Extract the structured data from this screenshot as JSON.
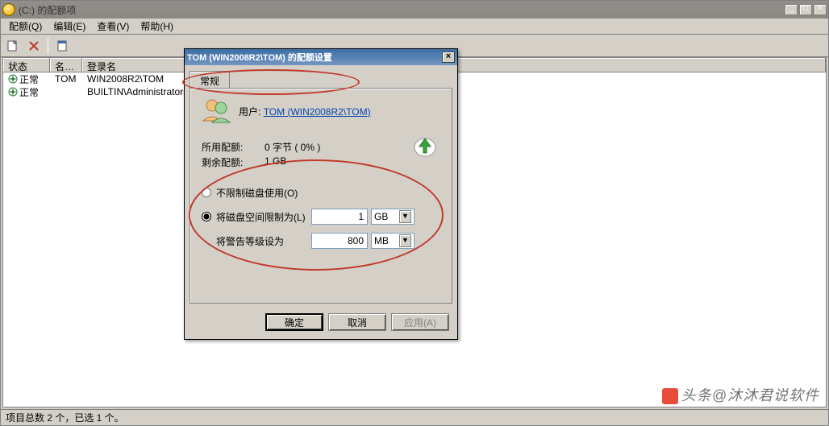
{
  "main": {
    "title": "(C:) 的配额项",
    "menu": {
      "quota": "配额(Q)",
      "edit": "编辑(E)",
      "view": "查看(V)",
      "help": "帮助(H)"
    },
    "columns": {
      "status": "状态",
      "name": "名…",
      "login": "登录名"
    },
    "rows": [
      {
        "status": "正常",
        "name": "TOM",
        "login": "WIN2008R2\\TOM"
      },
      {
        "status": "正常",
        "name": "",
        "login": "BUILTIN\\Administrators"
      }
    ],
    "statusbar": "项目总数 2 个，已选 1 个。"
  },
  "dialog": {
    "title": "TOM (WIN2008R2\\TOM) 的配额设置",
    "tab_general": "常规",
    "user_label": "用户:",
    "user_value": "TOM (WIN2008R2\\TOM)",
    "used_label": "所用配额:",
    "used_value": "0 字节 ( 0% )",
    "remain_label": "剩余配额:",
    "remain_value": "1 GB",
    "radio_nolimit": "不限制磁盘使用(O)",
    "radio_limit": "将磁盘空间限制为(L)",
    "warn_label": "将警告等级设为",
    "limit_value": "1",
    "limit_unit": "GB",
    "warn_value": "800",
    "warn_unit": "MB",
    "btn_ok": "确定",
    "btn_cancel": "取消",
    "btn_apply": "应用(A)"
  },
  "watermark": "头条@沐沐君说软件"
}
